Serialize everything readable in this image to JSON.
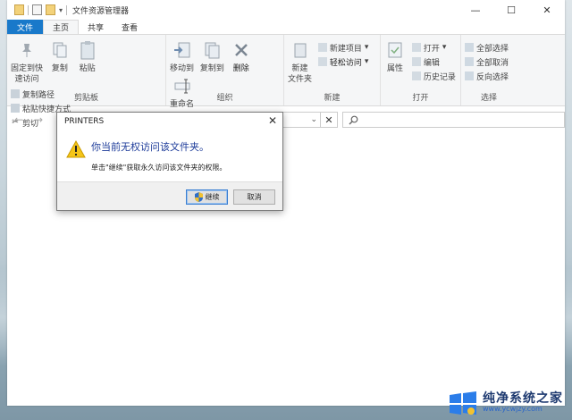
{
  "window": {
    "title": "文件资源管理器",
    "controls": [
      "—",
      "☐",
      "✕"
    ]
  },
  "tabs": [
    "文件",
    "主页",
    "共享",
    "查看"
  ],
  "ribbon": {
    "clipboard": {
      "pin": "固定到快\n速访问",
      "copy": "复制",
      "paste": "粘贴",
      "copy_path": "复制路径",
      "paste_shortcut": "粘贴快捷方式",
      "cut": "剪切",
      "label": "剪贴板"
    },
    "organize": {
      "move_to": "移动到",
      "copy_to": "复制到",
      "delete": "删除",
      "rename": "重命名",
      "label": "组织"
    },
    "new": {
      "new_folder": "新建\n文件夹",
      "new_item": "新建项目",
      "easy_access": "轻松访问",
      "label": "新建"
    },
    "open": {
      "properties": "属性",
      "open": "打开",
      "edit": "编辑",
      "history": "历史记录",
      "label": "打开"
    },
    "select": {
      "select_all": "全部选择",
      "select_none": "全部取消",
      "invert": "反向选择",
      "label": "选择"
    }
  },
  "address": {
    "dropdown": "⌄",
    "clear": "✕"
  },
  "dialog": {
    "title": "PRINTERS",
    "instruction": "你当前无权访问该文件夹。",
    "message": "单击\"继续\"获取永久访问该文件夹的权限。",
    "continue": "继续",
    "cancel": "取消"
  },
  "watermark": {
    "name": "纯净系统之家",
    "url": "www.ycwjzy.com"
  }
}
